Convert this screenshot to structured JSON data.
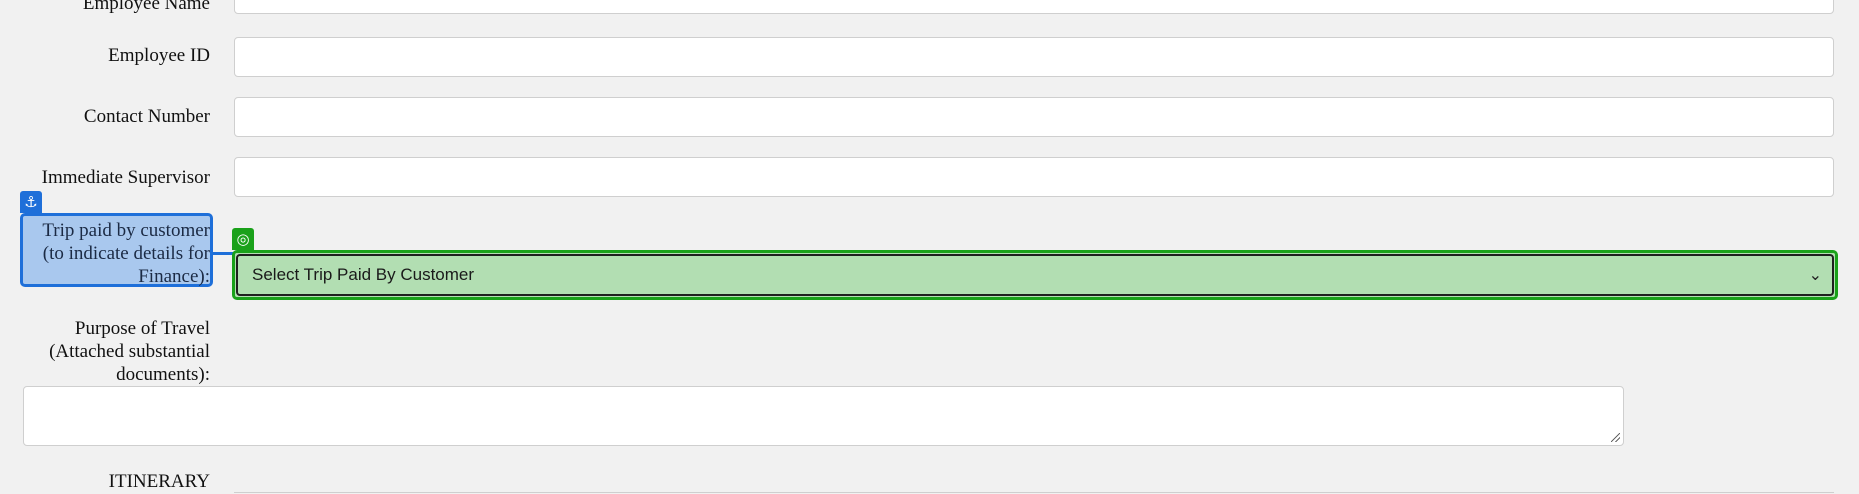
{
  "form": {
    "top_label": "Employee Name",
    "employee_id_label": "Employee ID",
    "contact_number_label": "Contact Number",
    "immediate_supervisor_label": "Immediate Supervisor",
    "trip_paid_label_line1": "Trip paid by customer",
    "trip_paid_label_line2": "(to indicate details for",
    "trip_paid_label_line3": "Finance):",
    "trip_paid_select_value": "Select Trip Paid By Customer",
    "purpose_label_line1": "Purpose of Travel",
    "purpose_label_line2": "(Attached substantial",
    "purpose_label_line3": "documents):",
    "itinerary_label": "ITINERARY"
  },
  "overlay": {
    "anchor_icon": "anchor-icon",
    "target_icon": "target-icon",
    "anchor_color": "#1e6fd9",
    "target_color": "#1aa11a"
  },
  "icons": {
    "anchor_glyph": "⚓",
    "target_glyph": "◎",
    "chevron_glyph": "⌄"
  }
}
